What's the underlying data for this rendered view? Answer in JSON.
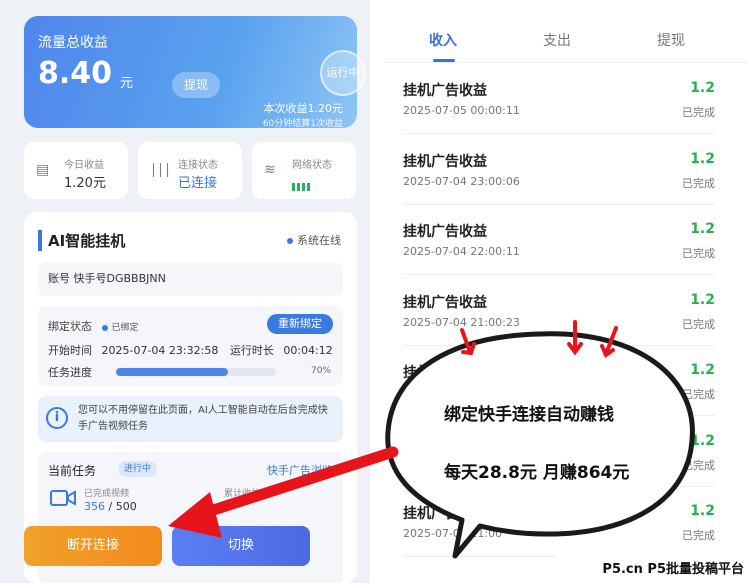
{
  "earnings": {
    "title": "流量总收益",
    "amount": "8.40",
    "unit": "元",
    "withdraw_label": "提现",
    "running_label": "运行中",
    "current_income": "本次收益1.20元",
    "settle_note": "60分钟结算1次收益"
  },
  "stats": {
    "today_label": "今日收益",
    "today_value": "1.20元",
    "conn_label": "连接状态",
    "conn_value": "已连接",
    "net_label": "网络状态"
  },
  "ai_panel": {
    "title": "AI智能挂机",
    "system_status": "系统在线",
    "account": "账号 快手号DGBBBJNN",
    "bind_label": "绑定状态",
    "bind_status": "已绑定",
    "rebind_label": "重新绑定",
    "start_time_label": "开始时间",
    "start_time": "2025-07-04 23:32:58",
    "runtime_label": "运行时长",
    "runtime": "00:04:12",
    "progress_label": "任务进度",
    "progress": 70,
    "progress_text": "70%",
    "info_text": "您可以不用停留在此页面，AI人工智能自动在后台完成快手广告视频任务",
    "task_label": "当前任务",
    "task_badge": "进行中",
    "task_link": "快手广告浏览",
    "done_label": "已完成视频",
    "done_value": "356",
    "done_total": " / 500",
    "earn_label": "累计收益",
    "disconnect_label": "断开连接",
    "switch_label": "切换"
  },
  "tabs": [
    "收入",
    "支出",
    "提现"
  ],
  "records": [
    {
      "title": "挂机广告收益",
      "date": "2025-07-05 00:00:11",
      "amount": "1.2",
      "status": "已完成"
    },
    {
      "title": "挂机广告收益",
      "date": "2025-07-04 23:00:06",
      "amount": "1.2",
      "status": "已完成"
    },
    {
      "title": "挂机广告收益",
      "date": "2025-07-04 22:00:11",
      "amount": "1.2",
      "status": "已完成"
    },
    {
      "title": "挂机广告收益",
      "date": "2025-07-04 21:00:23",
      "amount": "1.2",
      "status": "已完成"
    },
    {
      "title": "挂机广告收益",
      "date": "",
      "amount": "1.2",
      "status": "已完成"
    },
    {
      "title": "挂机广告收益",
      "date": "",
      "amount": "1.2",
      "status": "已完成"
    },
    {
      "title": "挂机广告收益",
      "date": "2025-07-04 21:00",
      "amount": "1.2",
      "status": "已完成"
    }
  ],
  "overlay": {
    "line1": "绑定快手连接自动赚钱",
    "line2": "每天28.8元 月赚864元",
    "watermark": "P5.cn P5批量投稿平台",
    "arrow_color": "#e8141c"
  }
}
